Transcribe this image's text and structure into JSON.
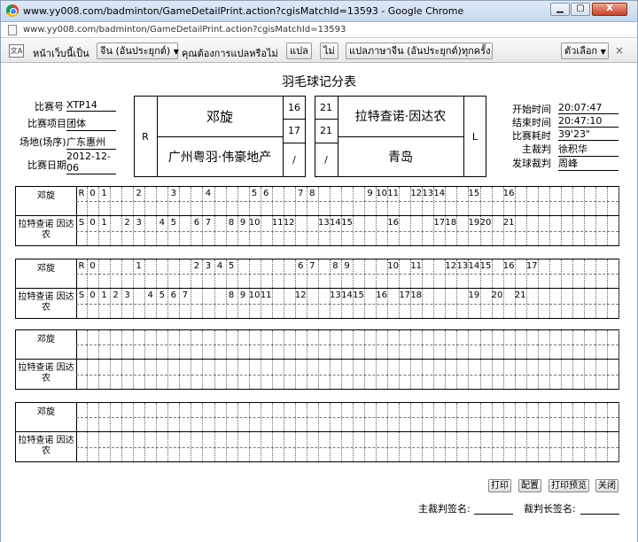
{
  "window": {
    "title": "www.yy008.com/badminton/GameDetailPrint.action?cgisMatchId=13593 - Google Chrome",
    "url": "www.yy008.com/badminton/GameDetailPrint.action?cgisMatchId=13593",
    "close_label": "X"
  },
  "translate_bar": {
    "prefix": "หน้าเว็บนี้เป็น",
    "language": "จีน (อันประยุกต์)",
    "question": "คุณต้องการแปลหรือไม่",
    "translate_button": "แปล",
    "no_button": "ไม่",
    "always_button": "แปลภาษาจีน (อันประยุกต์)ทุกครั้ง",
    "options_button": "ตัวเลือก",
    "close_label": "×"
  },
  "sheet": {
    "title": "羽毛球记分表",
    "match_no_label": "比赛号",
    "match_no": "XTP14",
    "event_label": "比赛项目",
    "event": "团体",
    "venue_label": "场地(场序)",
    "venue": "广东惠州",
    "date_label": "比赛日期",
    "date": "2012-12-06",
    "start_label": "开始时间",
    "start": "20:07:47",
    "end_label": "结束时间",
    "end": "20:47:10",
    "duration_label": "比赛耗时",
    "duration": "39'23\"",
    "umpire_label": "主裁判",
    "umpire": "徐积华",
    "service_judge_label": "发球裁判",
    "service_judge": "周峰"
  },
  "left_player": {
    "side": "R",
    "name": "邓旋",
    "team": "广州粤羽·伟豪地产",
    "scores": [
      "16",
      "17",
      "/"
    ]
  },
  "right_player": {
    "side": "L",
    "name": "拉特查诺·因达农",
    "team": "青岛",
    "scores": [
      "21",
      "21",
      "/"
    ]
  },
  "games": [
    {
      "p1": "邓旋",
      "p2": "拉特查诺 因达农",
      "p1_mark": "R",
      "p2_mark": "S",
      "p1_cells": [
        "0",
        "1",
        "",
        "",
        "2",
        "",
        "",
        "3",
        "",
        "",
        "4",
        "",
        "",
        "",
        "5",
        "6",
        "",
        "",
        "7",
        "8",
        "",
        "",
        "",
        "",
        "9",
        "10",
        "11",
        "",
        "12",
        "13",
        "14",
        "",
        "",
        "15",
        "",
        "",
        "16",
        "",
        "",
        "",
        "",
        "",
        "",
        "",
        "",
        "",
        "",
        ""
      ],
      "p2_cells": [
        "0",
        "1",
        "",
        "2",
        "3",
        "",
        "4",
        "5",
        "",
        "6",
        "7",
        "",
        "8",
        "9",
        "10",
        "",
        "11",
        "12",
        "",
        "",
        "13",
        "14",
        "15",
        "",
        "",
        "",
        "16",
        "",
        "",
        "",
        "17",
        "18",
        "",
        "19",
        "20",
        "",
        "21",
        "",
        "",
        "",
        "",
        "",
        "",
        "",
        "",
        "",
        "",
        ""
      ]
    },
    {
      "p1": "邓旋",
      "p2": "拉特查诺 因达农",
      "p1_mark": "R",
      "p2_mark": "S",
      "p1_cells": [
        "0",
        "",
        "",
        "",
        "1",
        "",
        "",
        "",
        "",
        "2",
        "3",
        "4",
        "5",
        "",
        "",
        "",
        "",
        "",
        "6",
        "7",
        "",
        "8",
        "9",
        "",
        "",
        "",
        "10",
        "",
        "11",
        "",
        "",
        "12",
        "13",
        "14",
        "15",
        "",
        "16",
        "",
        "17",
        "",
        "",
        "",
        "",
        "",
        "",
        "",
        "",
        ""
      ],
      "p2_cells": [
        "0",
        "1",
        "2",
        "3",
        "",
        "4",
        "5",
        "6",
        "7",
        "",
        "",
        "",
        "8",
        "9",
        "10",
        "11",
        "",
        "",
        "12",
        "",
        "",
        "13",
        "14",
        "15",
        "",
        "16",
        "",
        "17",
        "18",
        "",
        "",
        "",
        "",
        "19",
        "",
        "20",
        "",
        "21",
        "",
        "",
        "",
        "",
        "",
        "",
        "",
        "",
        ""
      ]
    },
    {
      "p1": "邓旋",
      "p2": "拉特查诺 因达农",
      "p1_mark": "",
      "p2_mark": "",
      "p1_cells": [],
      "p2_cells": []
    },
    {
      "p1": "邓旋",
      "p2": "拉特查诺 因达农",
      "p1_mark": "",
      "p2_mark": "",
      "p1_cells": [],
      "p2_cells": []
    }
  ],
  "buttons": {
    "print": "打印",
    "setup": "配置",
    "preview": "打印预览",
    "close": "关闭"
  },
  "signatures": {
    "umpire_sign": "主裁判签名:",
    "referee_sign": "裁判长签名:"
  }
}
